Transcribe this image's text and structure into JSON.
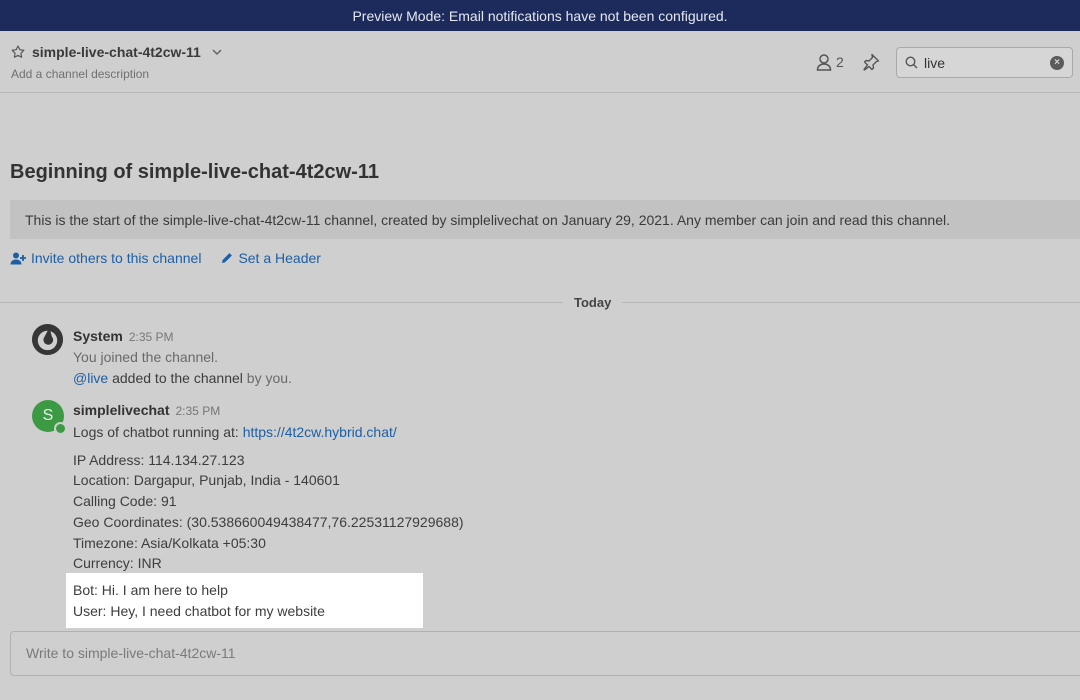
{
  "banner": {
    "text": "Preview Mode: Email notifications have not been configured."
  },
  "header": {
    "channel_name": "simple-live-chat-4t2cw-11",
    "channel_description": "Add a channel description",
    "member_count": "2",
    "search_value": "live"
  },
  "intro": {
    "title": "Beginning of simple-live-chat-4t2cw-11",
    "message": "This is the start of the simple-live-chat-4t2cw-11 channel, created by simplelivechat on January 29, 2021. Any member can join and read this channel.",
    "invite_label": "Invite others to this channel",
    "header_label": "Set a Header"
  },
  "divider": {
    "label": "Today"
  },
  "posts": [
    {
      "username": "System",
      "time": "2:35 PM",
      "line1": "You joined the channel.",
      "mention": "@live",
      "line2_mid": " added to the channel",
      "line2_end": " by you."
    },
    {
      "username": "simplelivechat",
      "avatar_letter": "S",
      "time": "2:35 PM",
      "logs_prefix": "Logs of chatbot running at: ",
      "logs_url": "https://4t2cw.hybrid.chat/",
      "details": [
        "IP Address: 114.134.27.123",
        "Location: Dargapur, Punjab, India - 140601",
        "Calling Code: 91",
        "Geo Coordinates: (30.538660049438477,76.22531127929688)",
        "Timezone: Asia/Kolkata +05:30",
        "Currency: INR"
      ],
      "transcript": [
        "Bot: Hi. I am here to help",
        "User: Hey, I need chatbot for my website"
      ]
    }
  ],
  "composer": {
    "placeholder": "Write to simple-live-chat-4t2cw-11"
  },
  "colors": {
    "banner_bg": "#1c2a5c",
    "link": "#1d5fa6",
    "avatar_green": "#3d9a44"
  }
}
